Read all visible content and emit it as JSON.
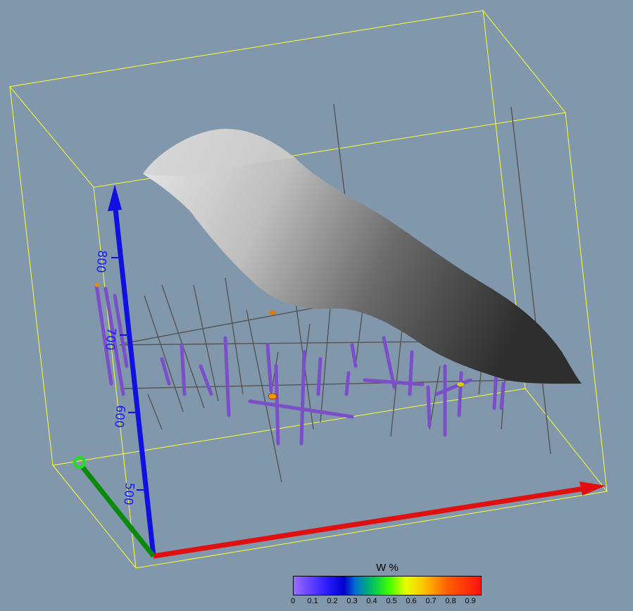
{
  "axes": {
    "vertical_tick_labels": [
      "800",
      "700",
      "600",
      "500"
    ],
    "colors": {
      "x_axis": "#e01010",
      "y_axis": "#0a8a0a",
      "z_axis": "#1010e0",
      "bounding_box": "#ffff33"
    }
  },
  "legend": {
    "title": "W %",
    "ticks": [
      "0",
      "0.1",
      "0.2",
      "0.3",
      "0.4",
      "0.5",
      "0.6",
      "0.7",
      "0.8",
      "0.9"
    ]
  },
  "scene": {
    "background": "#8197ab",
    "surface_color": "#9a9a9a",
    "drillhole_color": "#7a4fc8",
    "trace_color": "#5a5a5a"
  }
}
